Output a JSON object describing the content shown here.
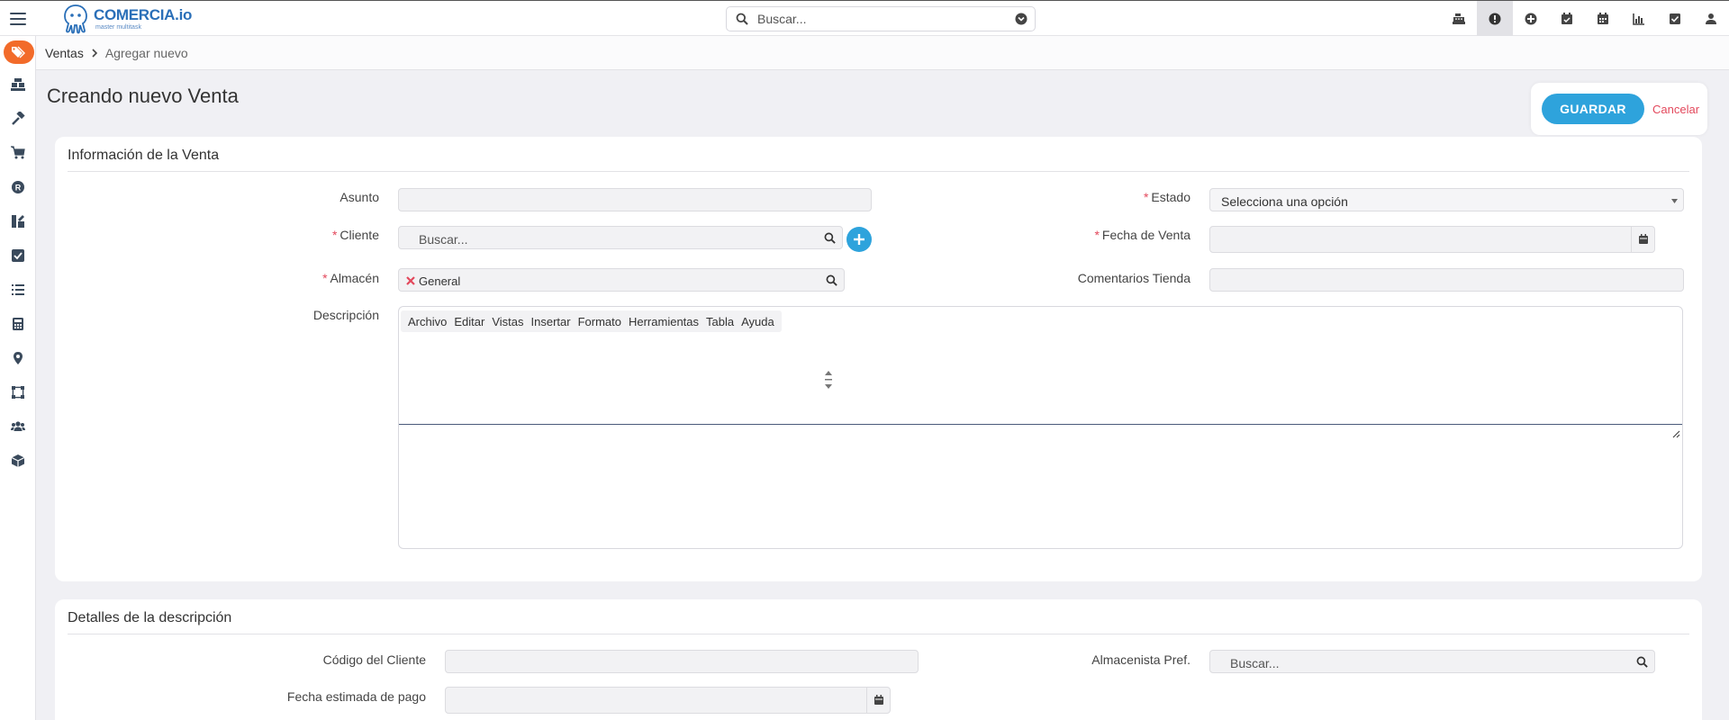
{
  "header": {
    "logo_name": "COMERCIA.io",
    "logo_tagline": "master multitask",
    "search_placeholder": "Buscar...",
    "icons": [
      "cash-register-icon",
      "alert-icon",
      "plus-circle-icon",
      "calendar-check-icon",
      "calendar-icon",
      "chart-icon",
      "checkbox-icon",
      "user-icon"
    ],
    "active_icon": "alert-icon"
  },
  "sidebar": {
    "items": [
      "tags-icon",
      "boxes-icon",
      "hammer-icon",
      "cart-icon",
      "registered-icon",
      "pencil-ruler-icon",
      "task-icon",
      "list-icon",
      "calculator-icon",
      "location-icon",
      "network-icon",
      "users-icon",
      "cube-icon"
    ],
    "active": "tags-icon",
    "accent": "#f26b2a"
  },
  "breadcrumb": {
    "module": "Ventas",
    "page": "Agregar nuevo"
  },
  "page_title": "Creando nuevo Venta",
  "actions": {
    "save_label": "GUARDAR",
    "cancel_label": "Cancelar",
    "save_color": "#2ea3dc",
    "cancel_color": "#e3485c"
  },
  "section1": {
    "title": "Información de la Venta",
    "asunto": {
      "label": "Asunto",
      "value": ""
    },
    "cliente": {
      "label": "Cliente",
      "placeholder": "Buscar..."
    },
    "almacen": {
      "label": "Almacén",
      "value": "General"
    },
    "descripcion": {
      "label": "Descripción"
    },
    "estado": {
      "label": "Estado",
      "value": "Selecciona una opción"
    },
    "fecha_venta": {
      "label": "Fecha de Venta",
      "value": ""
    },
    "comentarios": {
      "label": "Comentarios Tienda",
      "value": ""
    }
  },
  "editor": {
    "menu": [
      "Archivo",
      "Editar",
      "Vistas",
      "Insertar",
      "Formato",
      "Herramientas",
      "Tabla",
      "Ayuda"
    ]
  },
  "section2": {
    "title": "Detalles de la descripción",
    "codigo_cliente": {
      "label": "Código del Cliente",
      "value": ""
    },
    "fecha_pago": {
      "label": "Fecha estimada de pago",
      "value": ""
    },
    "almacenista": {
      "label": "Almacenista Pref.",
      "placeholder": "Buscar..."
    }
  }
}
